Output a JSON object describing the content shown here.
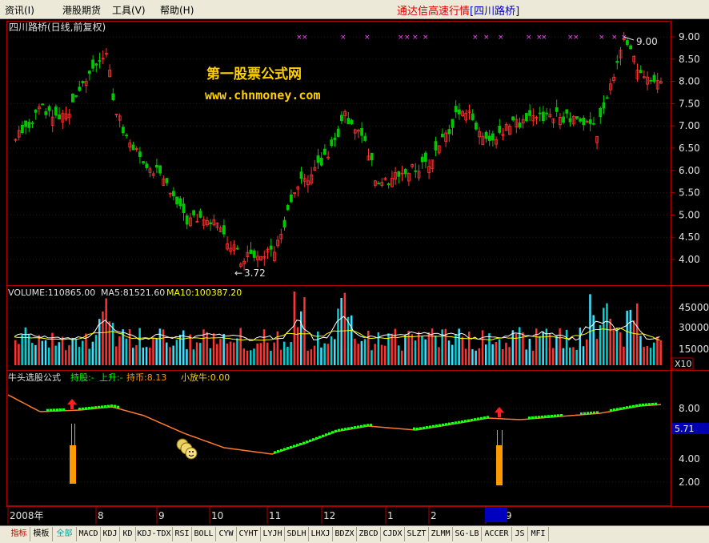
{
  "menu": {
    "items": [
      {
        "label": "资讯(I)",
        "x": 6
      },
      {
        "label": "港股期货",
        "x": 78
      },
      {
        "label": "工具(V)",
        "x": 140
      },
      {
        "label": "帮助(H)",
        "x": 200
      }
    ],
    "app_title": "通达信高速行情",
    "stock_tag": "[四川路桥]"
  },
  "price_panel": {
    "header": "四川路桥(日线,前复权)",
    "watermark_title": "第一股票公式网",
    "watermark_url": "www.chnmoney.com",
    "high_label": "9.00",
    "low_label": "3.72",
    "y_ticks": [
      "9.00",
      "8.50",
      "8.00",
      "7.50",
      "7.00",
      "6.50",
      "6.00",
      "5.50",
      "5.00",
      "4.50",
      "4.00"
    ]
  },
  "volume_panel": {
    "vol_label": "VOLUME:110865.00",
    "ma5_label": "MA5:81521.60",
    "ma10_label": "MA10:100387.20",
    "y_ticks": [
      "45000",
      "30000",
      "15000"
    ],
    "unit_badge": "X10"
  },
  "indicator_panel": {
    "name": "牛头选股公式",
    "hold_label": "持股:-",
    "rise_label": "上升:-",
    "coin_label": "持币:8.13",
    "bull_label": "小放牛:0.00",
    "y_ticks": [
      "8.00",
      "4.00",
      "2.00"
    ],
    "current_value": "5.71"
  },
  "time_axis": {
    "labels": [
      "2008年",
      "8",
      "9",
      "10",
      "11",
      "12",
      "1",
      "2",
      "2009"
    ]
  },
  "tabs": [
    "指标",
    "模板",
    "全部",
    "MACD",
    "KDJ",
    "KD",
    "KDJ-TDX",
    "RSI",
    "BOLL",
    "CYW",
    "CYHT",
    "LYJH",
    "SDLH",
    "LHXJ",
    "BDZX",
    "ZBCD",
    "CJDX",
    "SLZT",
    "ZLMM",
    "SG-LB",
    "ACCER",
    "JS",
    "MFI"
  ],
  "colors": {
    "up": "#ff3232",
    "down": "#00c800",
    "axis": "#b00000",
    "magenta": "#ff40ff",
    "orange": "#ff9900"
  }
}
